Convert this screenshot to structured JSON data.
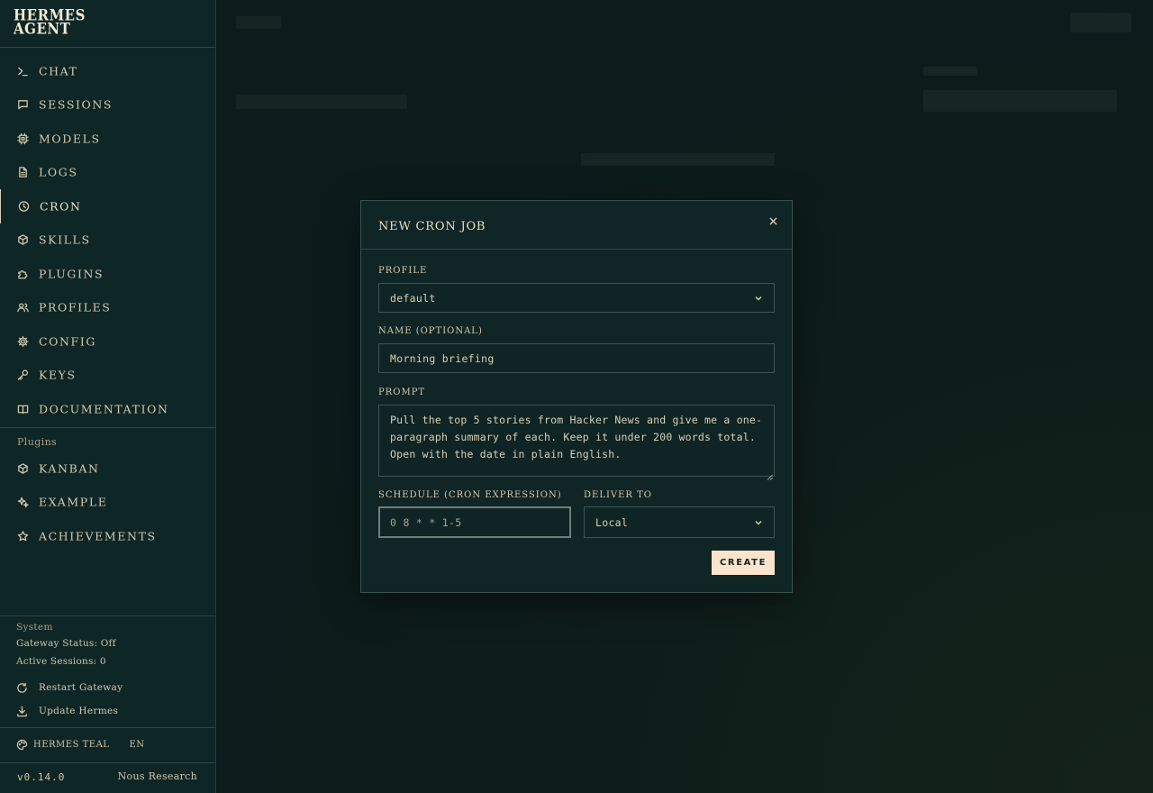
{
  "app": {
    "logo_line1": "HERMES",
    "logo_line2": "AGENT"
  },
  "sidebar": {
    "nav": [
      {
        "label": "CHAT",
        "icon": "terminal-icon"
      },
      {
        "label": "SESSIONS",
        "icon": "chat-bubble-icon"
      },
      {
        "label": "MODELS",
        "icon": "chip-icon"
      },
      {
        "label": "LOGS",
        "icon": "document-icon"
      },
      {
        "label": "CRON",
        "icon": "clock-icon",
        "active": true
      },
      {
        "label": "SKILLS",
        "icon": "cube-icon"
      },
      {
        "label": "PLUGINS",
        "icon": "puzzle-icon"
      },
      {
        "label": "PROFILES",
        "icon": "users-icon"
      },
      {
        "label": "CONFIG",
        "icon": "gear-icon"
      },
      {
        "label": "KEYS",
        "icon": "key-icon"
      },
      {
        "label": "DOCUMENTATION",
        "icon": "book-icon"
      }
    ],
    "plugins_title": "Plugins",
    "plugins": [
      {
        "label": "KANBAN",
        "icon": "cube-icon"
      },
      {
        "label": "EXAMPLE",
        "icon": "sparkle-icon"
      },
      {
        "label": "ACHIEVEMENTS",
        "icon": "star-icon"
      }
    ],
    "system": {
      "title": "System",
      "gateway_status": "Gateway Status: Off",
      "active_sessions": "Active Sessions: 0",
      "restart_label": "Restart Gateway",
      "update_label": "Update Hermes"
    },
    "theme_label": "HERMES TEAL",
    "language": "EN",
    "version": "v0.14.0",
    "credit": "Nous Research"
  },
  "modal": {
    "title": "NEW CRON JOB",
    "profile_label": "PROFILE",
    "profile_value": "default",
    "name_label": "NAME (OPTIONAL)",
    "name_value": "Morning briefing",
    "prompt_label": "PROMPT",
    "prompt_value": "Pull the top 5 stories from Hacker News and give me a one-paragraph summary of each. Keep it under 200 words total. Open with the date in plain English.",
    "schedule_label": "SCHEDULE (CRON EXPRESSION)",
    "schedule_value": "0 8 * * 1-5",
    "deliver_label": "DELIVER TO",
    "deliver_value": "Local",
    "create_label": "CREATE"
  },
  "colors": {
    "background": "#0d2222",
    "text": "#d9cfb4",
    "accent_button": "#fbe4cc"
  }
}
